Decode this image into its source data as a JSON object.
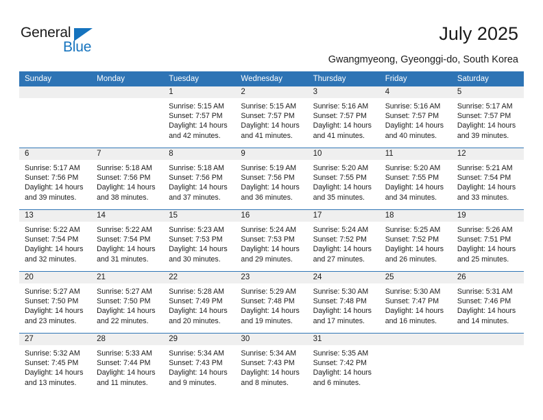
{
  "brand": {
    "word_one": "General",
    "word_two": "Blue",
    "triangle_icon": "blue-triangle-icon",
    "accent_color": "#1573BE"
  },
  "header": {
    "title": "July 2025",
    "subtitle": "Gwangmyeong, Gyeonggi-do, South Korea"
  },
  "calendar": {
    "header_color": "#2E74B5",
    "day_band_color": "#EFEFEF",
    "weekday_headers": [
      "Sunday",
      "Monday",
      "Tuesday",
      "Wednesday",
      "Thursday",
      "Friday",
      "Saturday"
    ],
    "weeks": [
      [
        {
          "day": "",
          "sunrise": "",
          "sunset": "",
          "daylight_line1": "",
          "daylight_line2": ""
        },
        {
          "day": "",
          "sunrise": "",
          "sunset": "",
          "daylight_line1": "",
          "daylight_line2": ""
        },
        {
          "day": "1",
          "sunrise": "Sunrise: 5:15 AM",
          "sunset": "Sunset: 7:57 PM",
          "daylight_line1": "Daylight: 14 hours",
          "daylight_line2": "and 42 minutes."
        },
        {
          "day": "2",
          "sunrise": "Sunrise: 5:15 AM",
          "sunset": "Sunset: 7:57 PM",
          "daylight_line1": "Daylight: 14 hours",
          "daylight_line2": "and 41 minutes."
        },
        {
          "day": "3",
          "sunrise": "Sunrise: 5:16 AM",
          "sunset": "Sunset: 7:57 PM",
          "daylight_line1": "Daylight: 14 hours",
          "daylight_line2": "and 41 minutes."
        },
        {
          "day": "4",
          "sunrise": "Sunrise: 5:16 AM",
          "sunset": "Sunset: 7:57 PM",
          "daylight_line1": "Daylight: 14 hours",
          "daylight_line2": "and 40 minutes."
        },
        {
          "day": "5",
          "sunrise": "Sunrise: 5:17 AM",
          "sunset": "Sunset: 7:57 PM",
          "daylight_line1": "Daylight: 14 hours",
          "daylight_line2": "and 39 minutes."
        }
      ],
      [
        {
          "day": "6",
          "sunrise": "Sunrise: 5:17 AM",
          "sunset": "Sunset: 7:56 PM",
          "daylight_line1": "Daylight: 14 hours",
          "daylight_line2": "and 39 minutes."
        },
        {
          "day": "7",
          "sunrise": "Sunrise: 5:18 AM",
          "sunset": "Sunset: 7:56 PM",
          "daylight_line1": "Daylight: 14 hours",
          "daylight_line2": "and 38 minutes."
        },
        {
          "day": "8",
          "sunrise": "Sunrise: 5:18 AM",
          "sunset": "Sunset: 7:56 PM",
          "daylight_line1": "Daylight: 14 hours",
          "daylight_line2": "and 37 minutes."
        },
        {
          "day": "9",
          "sunrise": "Sunrise: 5:19 AM",
          "sunset": "Sunset: 7:56 PM",
          "daylight_line1": "Daylight: 14 hours",
          "daylight_line2": "and 36 minutes."
        },
        {
          "day": "10",
          "sunrise": "Sunrise: 5:20 AM",
          "sunset": "Sunset: 7:55 PM",
          "daylight_line1": "Daylight: 14 hours",
          "daylight_line2": "and 35 minutes."
        },
        {
          "day": "11",
          "sunrise": "Sunrise: 5:20 AM",
          "sunset": "Sunset: 7:55 PM",
          "daylight_line1": "Daylight: 14 hours",
          "daylight_line2": "and 34 minutes."
        },
        {
          "day": "12",
          "sunrise": "Sunrise: 5:21 AM",
          "sunset": "Sunset: 7:54 PM",
          "daylight_line1": "Daylight: 14 hours",
          "daylight_line2": "and 33 minutes."
        }
      ],
      [
        {
          "day": "13",
          "sunrise": "Sunrise: 5:22 AM",
          "sunset": "Sunset: 7:54 PM",
          "daylight_line1": "Daylight: 14 hours",
          "daylight_line2": "and 32 minutes."
        },
        {
          "day": "14",
          "sunrise": "Sunrise: 5:22 AM",
          "sunset": "Sunset: 7:54 PM",
          "daylight_line1": "Daylight: 14 hours",
          "daylight_line2": "and 31 minutes."
        },
        {
          "day": "15",
          "sunrise": "Sunrise: 5:23 AM",
          "sunset": "Sunset: 7:53 PM",
          "daylight_line1": "Daylight: 14 hours",
          "daylight_line2": "and 30 minutes."
        },
        {
          "day": "16",
          "sunrise": "Sunrise: 5:24 AM",
          "sunset": "Sunset: 7:53 PM",
          "daylight_line1": "Daylight: 14 hours",
          "daylight_line2": "and 29 minutes."
        },
        {
          "day": "17",
          "sunrise": "Sunrise: 5:24 AM",
          "sunset": "Sunset: 7:52 PM",
          "daylight_line1": "Daylight: 14 hours",
          "daylight_line2": "and 27 minutes."
        },
        {
          "day": "18",
          "sunrise": "Sunrise: 5:25 AM",
          "sunset": "Sunset: 7:52 PM",
          "daylight_line1": "Daylight: 14 hours",
          "daylight_line2": "and 26 minutes."
        },
        {
          "day": "19",
          "sunrise": "Sunrise: 5:26 AM",
          "sunset": "Sunset: 7:51 PM",
          "daylight_line1": "Daylight: 14 hours",
          "daylight_line2": "and 25 minutes."
        }
      ],
      [
        {
          "day": "20",
          "sunrise": "Sunrise: 5:27 AM",
          "sunset": "Sunset: 7:50 PM",
          "daylight_line1": "Daylight: 14 hours",
          "daylight_line2": "and 23 minutes."
        },
        {
          "day": "21",
          "sunrise": "Sunrise: 5:27 AM",
          "sunset": "Sunset: 7:50 PM",
          "daylight_line1": "Daylight: 14 hours",
          "daylight_line2": "and 22 minutes."
        },
        {
          "day": "22",
          "sunrise": "Sunrise: 5:28 AM",
          "sunset": "Sunset: 7:49 PM",
          "daylight_line1": "Daylight: 14 hours",
          "daylight_line2": "and 20 minutes."
        },
        {
          "day": "23",
          "sunrise": "Sunrise: 5:29 AM",
          "sunset": "Sunset: 7:48 PM",
          "daylight_line1": "Daylight: 14 hours",
          "daylight_line2": "and 19 minutes."
        },
        {
          "day": "24",
          "sunrise": "Sunrise: 5:30 AM",
          "sunset": "Sunset: 7:48 PM",
          "daylight_line1": "Daylight: 14 hours",
          "daylight_line2": "and 17 minutes."
        },
        {
          "day": "25",
          "sunrise": "Sunrise: 5:30 AM",
          "sunset": "Sunset: 7:47 PM",
          "daylight_line1": "Daylight: 14 hours",
          "daylight_line2": "and 16 minutes."
        },
        {
          "day": "26",
          "sunrise": "Sunrise: 5:31 AM",
          "sunset": "Sunset: 7:46 PM",
          "daylight_line1": "Daylight: 14 hours",
          "daylight_line2": "and 14 minutes."
        }
      ],
      [
        {
          "day": "27",
          "sunrise": "Sunrise: 5:32 AM",
          "sunset": "Sunset: 7:45 PM",
          "daylight_line1": "Daylight: 14 hours",
          "daylight_line2": "and 13 minutes."
        },
        {
          "day": "28",
          "sunrise": "Sunrise: 5:33 AM",
          "sunset": "Sunset: 7:44 PM",
          "daylight_line1": "Daylight: 14 hours",
          "daylight_line2": "and 11 minutes."
        },
        {
          "day": "29",
          "sunrise": "Sunrise: 5:34 AM",
          "sunset": "Sunset: 7:43 PM",
          "daylight_line1": "Daylight: 14 hours",
          "daylight_line2": "and 9 minutes."
        },
        {
          "day": "30",
          "sunrise": "Sunrise: 5:34 AM",
          "sunset": "Sunset: 7:43 PM",
          "daylight_line1": "Daylight: 14 hours",
          "daylight_line2": "and 8 minutes."
        },
        {
          "day": "31",
          "sunrise": "Sunrise: 5:35 AM",
          "sunset": "Sunset: 7:42 PM",
          "daylight_line1": "Daylight: 14 hours",
          "daylight_line2": "and 6 minutes."
        },
        {
          "day": "",
          "sunrise": "",
          "sunset": "",
          "daylight_line1": "",
          "daylight_line2": ""
        },
        {
          "day": "",
          "sunrise": "",
          "sunset": "",
          "daylight_line1": "",
          "daylight_line2": ""
        }
      ]
    ]
  }
}
